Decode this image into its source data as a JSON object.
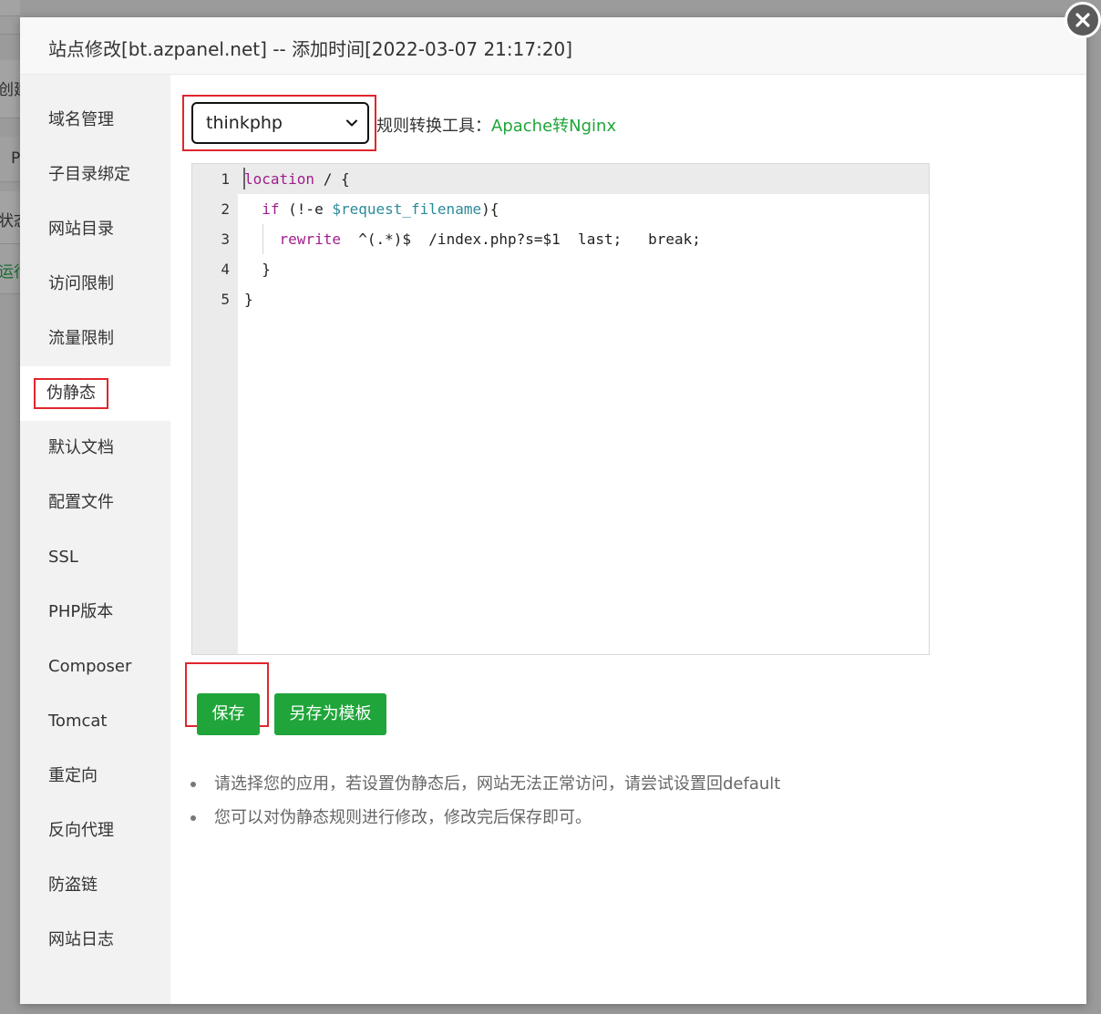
{
  "background": {
    "fragments": [
      "创建",
      "P",
      "状态",
      "运行"
    ]
  },
  "dialog": {
    "title": "站点修改[bt.azpanel.net] -- 添加时间[2022-03-07 21:17:20]",
    "close_icon": "close-icon"
  },
  "sidebar": {
    "items": [
      {
        "label": "域名管理"
      },
      {
        "label": "子目录绑定"
      },
      {
        "label": "网站目录"
      },
      {
        "label": "访问限制"
      },
      {
        "label": "流量限制"
      },
      {
        "label": "伪静态",
        "active": true
      },
      {
        "label": "默认文档"
      },
      {
        "label": "配置文件"
      },
      {
        "label": "SSL"
      },
      {
        "label": "PHP版本"
      },
      {
        "label": "Composer"
      },
      {
        "label": "Tomcat"
      },
      {
        "label": "重定向"
      },
      {
        "label": "反向代理"
      },
      {
        "label": "防盗链"
      },
      {
        "label": "网站日志"
      }
    ]
  },
  "rewrite": {
    "selected_rule": "thinkphp",
    "converter_label": "规则转换工具：",
    "converter_link": "Apache转Nginx",
    "code_lines": [
      {
        "n": "1",
        "parts": [
          {
            "t": "location",
            "c": "kw"
          },
          {
            "t": " / {",
            "c": ""
          }
        ]
      },
      {
        "n": "2",
        "parts": [
          {
            "t": "  ",
            "c": ""
          },
          {
            "t": "if",
            "c": "kw"
          },
          {
            "t": " (!-e ",
            "c": ""
          },
          {
            "t": "$request_filename",
            "c": "var"
          },
          {
            "t": "){",
            "c": ""
          }
        ]
      },
      {
        "n": "3",
        "parts": [
          {
            "t": "    ",
            "c": ""
          },
          {
            "t": "rewrite",
            "c": "kw"
          },
          {
            "t": "  ^(.*)$  /index.php?s=$1  last;   break;",
            "c": ""
          }
        ]
      },
      {
        "n": "4",
        "parts": [
          {
            "t": "  }",
            "c": ""
          }
        ]
      },
      {
        "n": "5",
        "parts": [
          {
            "t": "}",
            "c": ""
          }
        ]
      }
    ],
    "save_label": "保存",
    "save_template_label": "另存为模板",
    "tips": [
      "请选择您的应用，若设置伪静态后，网站无法正常访问，请尝试设置回default",
      "您可以对伪静态规则进行修改，修改完后保存即可。"
    ]
  },
  "colors": {
    "accent": "#20a53a",
    "highlight": "#e0262d"
  }
}
